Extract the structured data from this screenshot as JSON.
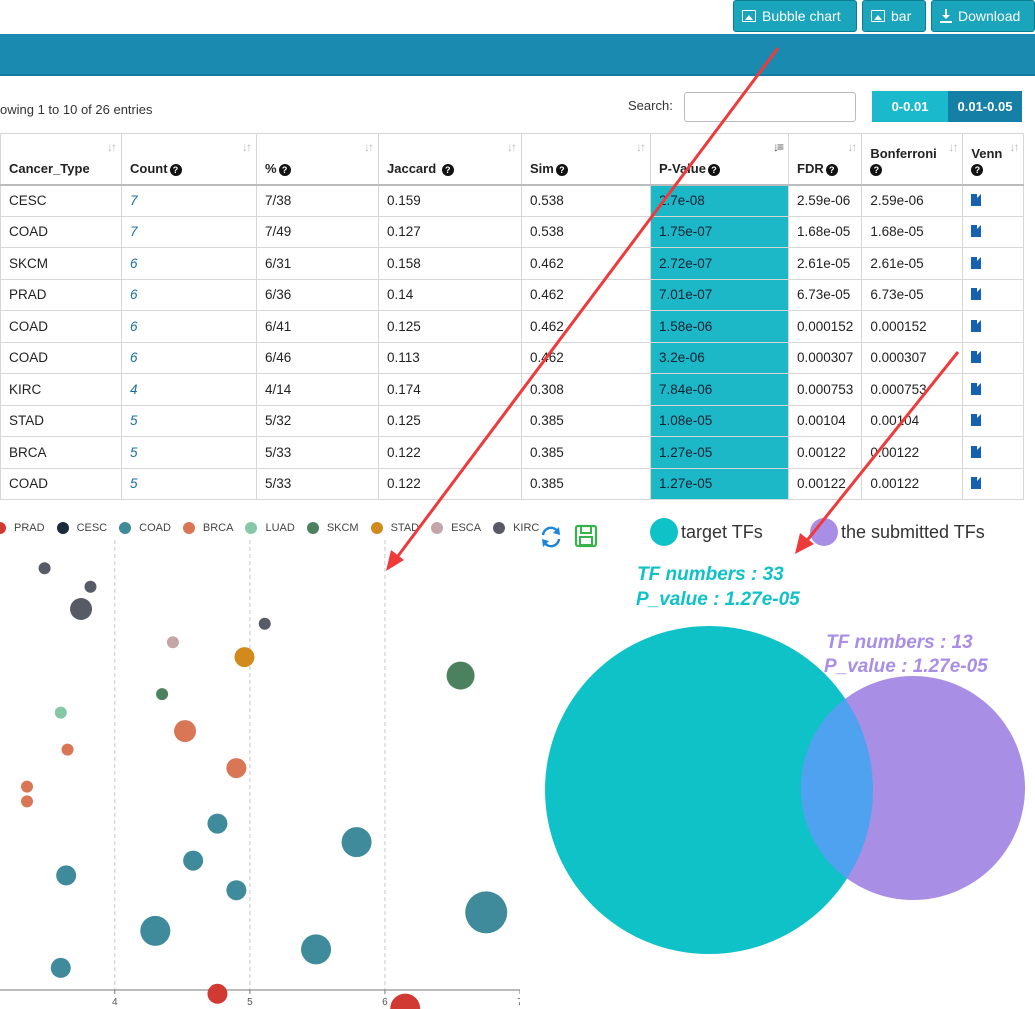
{
  "toolbar": {
    "bubble_label": "Bubble chart",
    "bar_label": "bar",
    "download_label": "Download"
  },
  "table_info": "owing 1 to 10 of 26 entries",
  "search": {
    "label": "Search:",
    "value": ""
  },
  "filters": [
    "0-0.01",
    "0.01-0.05"
  ],
  "table": {
    "headers": [
      "Cancer_Type",
      "Count",
      "%",
      "Jaccard",
      "Sim",
      "P-Value",
      "FDR",
      "Bonferroni",
      "Venn"
    ],
    "rows": [
      [
        "CESC",
        "7",
        "7/38",
        "0.159",
        "0.538",
        "2.7e-08",
        "2.59e-06",
        "2.59e-06"
      ],
      [
        "COAD",
        "7",
        "7/49",
        "0.127",
        "0.538",
        "1.75e-07",
        "1.68e-05",
        "1.68e-05"
      ],
      [
        "SKCM",
        "6",
        "6/31",
        "0.158",
        "0.462",
        "2.72e-07",
        "2.61e-05",
        "2.61e-05"
      ],
      [
        "PRAD",
        "6",
        "6/36",
        "0.14",
        "0.462",
        "7.01e-07",
        "6.73e-05",
        "6.73e-05"
      ],
      [
        "COAD",
        "6",
        "6/41",
        "0.125",
        "0.462",
        "1.58e-06",
        "0.000152",
        "0.000152"
      ],
      [
        "COAD",
        "6",
        "6/46",
        "0.113",
        "0.462",
        "3.2e-06",
        "0.000307",
        "0.000307"
      ],
      [
        "KIRC",
        "4",
        "4/14",
        "0.174",
        "0.308",
        "7.84e-06",
        "0.000753",
        "0.000753"
      ],
      [
        "STAD",
        "5",
        "5/32",
        "0.125",
        "0.385",
        "1.08e-05",
        "0.00104",
        "0.00104"
      ],
      [
        "BRCA",
        "5",
        "5/33",
        "0.122",
        "0.385",
        "1.27e-05",
        "0.00122",
        "0.00122"
      ],
      [
        "COAD",
        "5",
        "5/33",
        "0.122",
        "0.385",
        "1.27e-05",
        "0.00122",
        "0.00122"
      ]
    ]
  },
  "bubble_legend": [
    {
      "name": "PRAD",
      "color": "#d13a32"
    },
    {
      "name": "CESC",
      "color": "#1c2b3c"
    },
    {
      "name": "COAD",
      "color": "#3f8b9c"
    },
    {
      "name": "BRCA",
      "color": "#d97655"
    },
    {
      "name": "LUAD",
      "color": "#86c7a8"
    },
    {
      "name": "SKCM",
      "color": "#4c8160"
    },
    {
      "name": "STAD",
      "color": "#d28a1c"
    },
    {
      "name": "ESCA",
      "color": "#c4a6a8"
    },
    {
      "name": "KIRC",
      "color": "#565b66"
    }
  ],
  "chart_data": {
    "type": "scatter",
    "xlim": [
      3.15,
      7.0
    ],
    "x_ticks": [
      "4",
      "5",
      "6",
      "7"
    ],
    "grid": "vertical dashed",
    "points": [
      {
        "type": "KIRC",
        "x": 3.48,
        "y": 0.955,
        "r": 6
      },
      {
        "type": "KIRC",
        "x": 3.82,
        "y": 0.93,
        "r": 6
      },
      {
        "type": "KIRC",
        "x": 3.75,
        "y": 0.9,
        "r": 11
      },
      {
        "type": "KIRC",
        "x": 5.11,
        "y": 0.88,
        "r": 6
      },
      {
        "type": "ESCA",
        "x": 4.43,
        "y": 0.855,
        "r": 6
      },
      {
        "type": "STAD",
        "x": 4.96,
        "y": 0.835,
        "r": 10
      },
      {
        "type": "SKCM",
        "x": 6.56,
        "y": 0.81,
        "r": 14
      },
      {
        "type": "SKCM",
        "x": 4.35,
        "y": 0.785,
        "r": 6
      },
      {
        "type": "LUAD",
        "x": 3.6,
        "y": 0.76,
        "r": 6
      },
      {
        "type": "BRCA",
        "x": 4.52,
        "y": 0.735,
        "r": 11
      },
      {
        "type": "BRCA",
        "x": 3.65,
        "y": 0.71,
        "r": 6
      },
      {
        "type": "BRCA",
        "x": 4.9,
        "y": 0.685,
        "r": 10
      },
      {
        "type": "BRCA",
        "x": 3.35,
        "y": 0.66,
        "r": 6
      },
      {
        "type": "BRCA",
        "x": 3.35,
        "y": 0.64,
        "r": 6
      },
      {
        "type": "COAD",
        "x": 4.76,
        "y": 0.61,
        "r": 10
      },
      {
        "type": "COAD",
        "x": 5.79,
        "y": 0.585,
        "r": 15
      },
      {
        "type": "COAD",
        "x": 4.58,
        "y": 0.56,
        "r": 10
      },
      {
        "type": "COAD",
        "x": 3.64,
        "y": 0.54,
        "r": 10
      },
      {
        "type": "COAD",
        "x": 4.9,
        "y": 0.52,
        "r": 10
      },
      {
        "type": "COAD",
        "x": 6.75,
        "y": 0.49,
        "r": 21
      },
      {
        "type": "COAD",
        "x": 4.3,
        "y": 0.465,
        "r": 15
      },
      {
        "type": "COAD",
        "x": 5.49,
        "y": 0.44,
        "r": 15
      },
      {
        "type": "COAD",
        "x": 3.6,
        "y": 0.415,
        "r": 10
      },
      {
        "type": "PRAD",
        "x": 4.76,
        "y": 0.38,
        "r": 10
      },
      {
        "type": "PRAD",
        "x": 6.15,
        "y": 0.36,
        "r": 15
      }
    ]
  },
  "venn": {
    "legend_target": "target TFs",
    "legend_submitted": "the submitted TFs",
    "target_color": "#0ec2c8",
    "submitted_color": "#a98ee6",
    "overlap_color": "#4fa2f0",
    "target_numbers": "TF numbers : 33",
    "target_pvalue": "P_value : 1.27e-05",
    "submitted_numbers": "TF numbers : 13",
    "submitted_pvalue": "P_value : 1.27e-05",
    "target_count": 33,
    "submitted_count": 13
  },
  "icons": {
    "refresh": "refresh-icon",
    "save": "save-icon",
    "sort": "sort-icon",
    "help": "question-circle-icon",
    "venn_file": "file-icon"
  },
  "arrow_color": "#ee3a3a"
}
